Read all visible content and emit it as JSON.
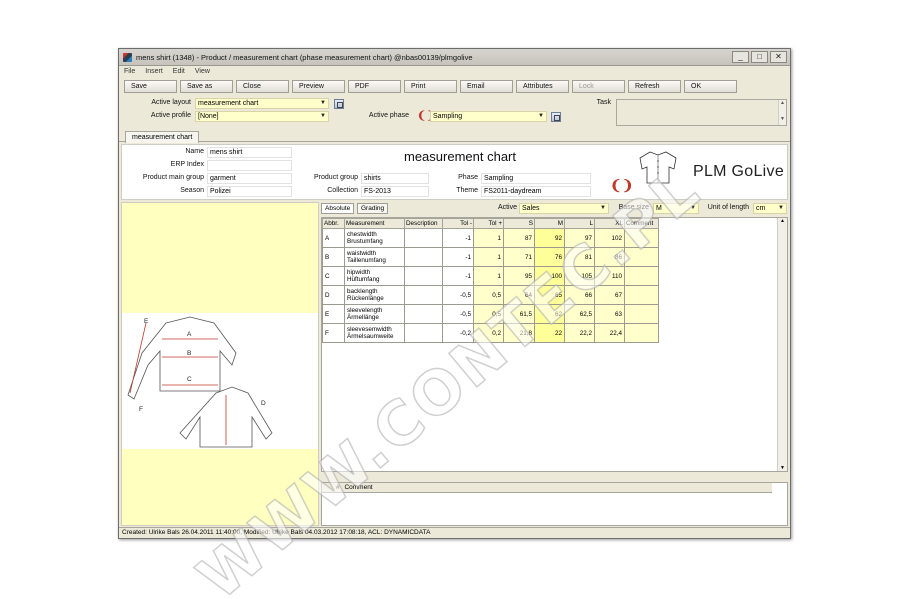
{
  "window": {
    "title": "mens shirt (1348) - Product / measurement chart (phase measurement chart) @nbas00139/plmgolive",
    "buttons": [
      "_",
      "□",
      "✕"
    ]
  },
  "menu": [
    "File",
    "Insert",
    "Edit",
    "View"
  ],
  "toolbar": [
    "Save",
    "Save as",
    "Close",
    "Preview",
    "PDF",
    "Print",
    "Email",
    "Attributes",
    "Lock",
    "Refresh",
    "OK"
  ],
  "controls": {
    "active_layout_label": "Active layout",
    "active_layout_value": "measurement chart",
    "active_profile_label": "Active profile",
    "active_profile_value": "[None]",
    "active_phase_label": "Active phase",
    "active_phase_value": "Sampling",
    "task_label": "Task",
    "dropdown_arrow": "▼",
    "scroll_up": "▲",
    "scroll_down": "▼"
  },
  "tab": "measurement chart",
  "header": {
    "chart_title": "measurement chart",
    "brand": "PLM GoLive",
    "name_label": "Name",
    "name_value": "mens shirt",
    "erp_label": "ERP Index",
    "erp_value": "",
    "main_group_label": "Product main group",
    "main_group_value": "garment",
    "season_label": "Season",
    "season_value": "Polizei",
    "group_label": "Product group",
    "group_value": "shirts",
    "collection_label": "Collection",
    "collection_value": "FS-2013",
    "phase_label": "Phase",
    "phase_value": "Sampling",
    "theme_label": "Theme",
    "theme_value": "FS2011-daydream"
  },
  "grid_controls": {
    "tab_absolute": "Absolute",
    "tab_grading": "Grading",
    "active_label": "Active",
    "active_value": "Sales",
    "base_size_label": "Base size",
    "base_size_value": "M",
    "unit_label": "Unit of length",
    "unit_value": "cm"
  },
  "table": {
    "headers": [
      "Abbr.",
      "Measurement",
      "Description",
      "Tol -",
      "Tol +",
      "S",
      "M",
      "L",
      "XL",
      "Comment"
    ],
    "rows": [
      {
        "abbr": "A",
        "m1": "chestwidth",
        "m2": "Brustumfang",
        "desc": "",
        "tolm": "-1",
        "tolp": "1",
        "s": "87",
        "m": "92",
        "l": "97",
        "xl": "102",
        "comment": ""
      },
      {
        "abbr": "B",
        "m1": "waistwidth",
        "m2": "Taillenumfang",
        "desc": "",
        "tolm": "-1",
        "tolp": "1",
        "s": "71",
        "m": "76",
        "l": "81",
        "xl": "86",
        "comment": ""
      },
      {
        "abbr": "C",
        "m1": "hipwidth",
        "m2": "Hüftumfang",
        "desc": "",
        "tolm": "-1",
        "tolp": "1",
        "s": "95",
        "m": "100",
        "l": "105",
        "xl": "110",
        "comment": ""
      },
      {
        "abbr": "D",
        "m1": "backlength",
        "m2": "Rückenlänge",
        "desc": "",
        "tolm": "-0,5",
        "tolp": "0,5",
        "s": "64",
        "m": "65",
        "l": "66",
        "xl": "67",
        "comment": ""
      },
      {
        "abbr": "E",
        "m1": "sleevelength",
        "m2": "Ärmellänge",
        "desc": "",
        "tolm": "-0,5",
        "tolp": "0,5",
        "s": "61,5",
        "m": "62",
        "l": "62,5",
        "xl": "63",
        "comment": ""
      },
      {
        "abbr": "F",
        "m1": "sleevesemwidth",
        "m2": "Ärmelsaumweite",
        "desc": "",
        "tolm": "-0,2",
        "tolp": "0,2",
        "s": "21,8",
        "m": "22",
        "l": "22,2",
        "xl": "22,4",
        "comment": ""
      }
    ]
  },
  "sketch_labels": [
    "A",
    "B",
    "C",
    "D",
    "E",
    "F"
  ],
  "comment_header": {
    "hash": "#",
    "label": "Comment"
  },
  "status": "Created: Ulrike Bals 26.04.2011 11:40:00, Modified: Ulrike Bals 04.03.2012 17:08:18, ACL: DYNAMICDATA",
  "watermark": "WWW.CONTEC.PL"
}
